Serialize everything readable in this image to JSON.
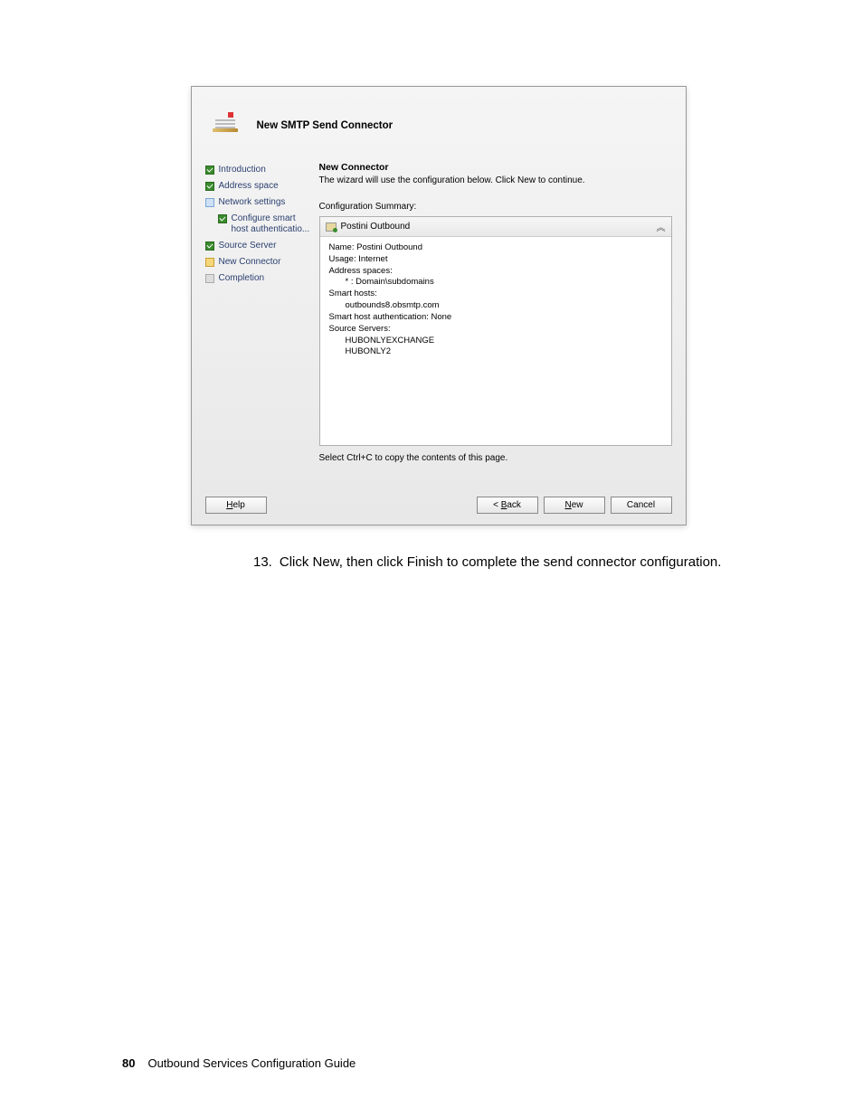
{
  "dialog": {
    "title": "New SMTP Send Connector",
    "nav": [
      {
        "label": "Introduction",
        "state": "green",
        "indent": false
      },
      {
        "label": "Address space",
        "state": "green",
        "indent": false
      },
      {
        "label": "Network settings",
        "state": "blue",
        "indent": false
      },
      {
        "label": "Configure smart host authenticatio...",
        "state": "green",
        "indent": true
      },
      {
        "label": "Source Server",
        "state": "green",
        "indent": false
      },
      {
        "label": "New Connector",
        "state": "yellow",
        "indent": false
      },
      {
        "label": "Completion",
        "state": "grey",
        "indent": false
      }
    ],
    "main": {
      "heading": "New Connector",
      "subtext": "The wizard will use the configuration below.  Click New to continue.",
      "summary_label": "Configuration Summary:",
      "summary_name": "Postini Outbound",
      "details": {
        "name": "Name: Postini Outbound",
        "usage": "Usage: Internet",
        "address_spaces_label": "Address spaces:",
        "address_space": "* : Domain\\subdomains",
        "smart_hosts_label": "Smart hosts:",
        "smart_host": "outbounds8.obsmtp.com",
        "auth": "Smart host authentication: None",
        "source_servers_label": "Source Servers:",
        "server1": "HUBONLYEXCHANGE",
        "server2": "HUBONLY2"
      },
      "copy_hint": "Select Ctrl+C to copy the contents of this page."
    },
    "buttons": {
      "help": "Help",
      "back": "< Back",
      "new": "New",
      "cancel": "Cancel"
    }
  },
  "step": {
    "number": "13.",
    "text": "Click New, then click Finish to complete the send connector configuration."
  },
  "footer": {
    "page": "80",
    "title": "Outbound Services Configuration Guide"
  }
}
